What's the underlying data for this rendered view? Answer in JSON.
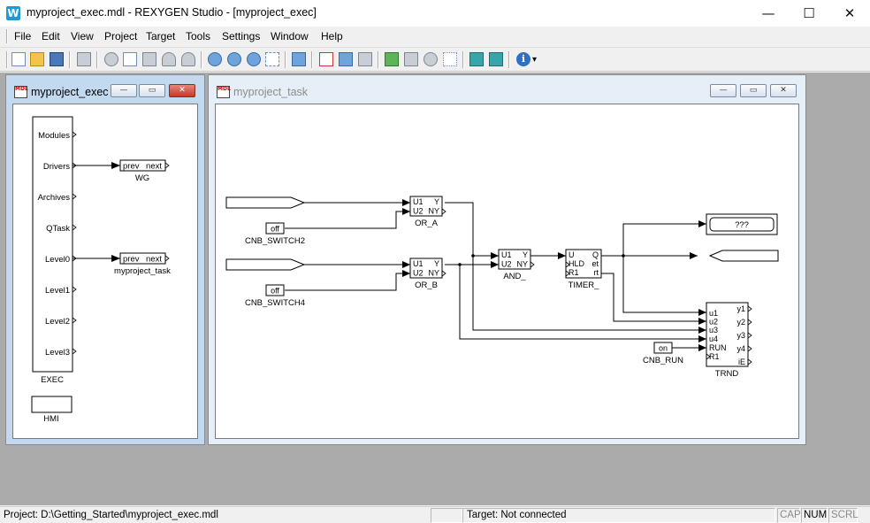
{
  "window": {
    "title": "myproject_exec.mdl - REXYGEN Studio - [myproject_exec]",
    "app_icon_glyph": "W",
    "minimize_glyph": "—",
    "maximize_glyph": "☐",
    "close_glyph": "✕"
  },
  "menu": [
    "File",
    "Edit",
    "View",
    "Project",
    "Target",
    "Tools",
    "Settings",
    "Window",
    "Help"
  ],
  "toolbar": {
    "icons": [
      "new-document-icon",
      "open-folder-icon",
      "save-icon",
      "print-icon",
      "cut-icon",
      "copy-icon",
      "paste-icon",
      "undo-icon",
      "redo-icon",
      "zoom-in-icon",
      "zoom-out-icon",
      "zoom-fit-icon",
      "zoom-select-icon",
      "block-icon",
      "compile-icon",
      "download-icon",
      "debug-icon",
      "add-block-icon",
      "remove-block-icon",
      "gear-icon",
      "list-icon",
      "watch-icon",
      "trend-icon",
      "info-icon"
    ],
    "info_glyph": "i",
    "dropdown_glyph": "▾"
  },
  "exec_window": {
    "title": "myproject_exec",
    "icon_text": "MDL",
    "btn_min": "—",
    "btn_max": "▭",
    "btn_close": "✕",
    "exec_block": {
      "name": "EXEC",
      "ports": [
        "Modules",
        "Drivers",
        "Archives",
        "QTask",
        "Level0",
        "Level1",
        "Level2",
        "Level3"
      ]
    },
    "wg_block": {
      "name": "WG",
      "in": "prev",
      "out": "next"
    },
    "task_block": {
      "name": "myproject_task",
      "in": "prev",
      "out": "next"
    },
    "hmi_block": {
      "name": "HMI"
    }
  },
  "task_window": {
    "title": "myproject_task",
    "icon_text": "MDL",
    "btn_min": "—",
    "btn_max": "▭",
    "btn_close": "✕",
    "blocks": {
      "or_a": {
        "name": "OR_A",
        "in1": "U1",
        "in2": "U2",
        "out1": "Y",
        "out2": "NY"
      },
      "or_b": {
        "name": "OR_B",
        "in1": "U1",
        "in2": "U2",
        "out1": "Y",
        "out2": "NY"
      },
      "and": {
        "name": "AND_",
        "in1": "U1",
        "in2": "U2",
        "out1": "Y",
        "out2": "NY"
      },
      "timer": {
        "name": "TIMER_",
        "in1": "U",
        "in2": "HLD",
        "in3": "R1",
        "out1": "Q",
        "out2": "et",
        "out3": "rt"
      },
      "switch2": {
        "name": "CNB_SWITCH2",
        "value": "off"
      },
      "switch4": {
        "name": "CNB_SWITCH4",
        "value": "off"
      },
      "run": {
        "name": "CNB_RUN",
        "value": "on"
      },
      "display": {
        "value": "???"
      },
      "trnd": {
        "name": "TRND",
        "inputs": [
          "u1",
          "u2",
          "u3",
          "u4",
          "RUN",
          "R1"
        ],
        "outputs": [
          "y1",
          "y2",
          "y3",
          "y4",
          "iE"
        ]
      }
    }
  },
  "status": {
    "path": "Project: D:\\Getting_Started\\myproject_exec.mdl",
    "target": "Target: Not connected",
    "cap": "CAP",
    "num": "NUM",
    "scrl": "SCRL"
  }
}
